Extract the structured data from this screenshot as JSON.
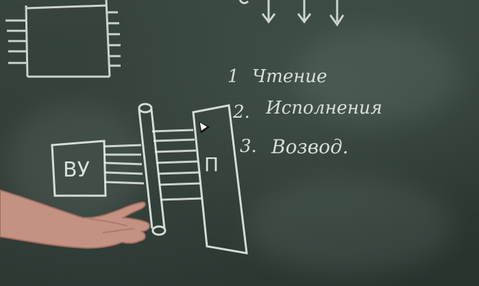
{
  "scene": {
    "board_color": "#2f3b35",
    "chalk_color": "#e8eee9"
  },
  "board": {
    "list": [
      {
        "number": "1",
        "text": "Чтение"
      },
      {
        "number": "2.",
        "text": "Исполнения"
      },
      {
        "number": "3.",
        "text": "Возвод."
      }
    ],
    "box_vu_label": "ВУ",
    "box_p_label": "П"
  }
}
